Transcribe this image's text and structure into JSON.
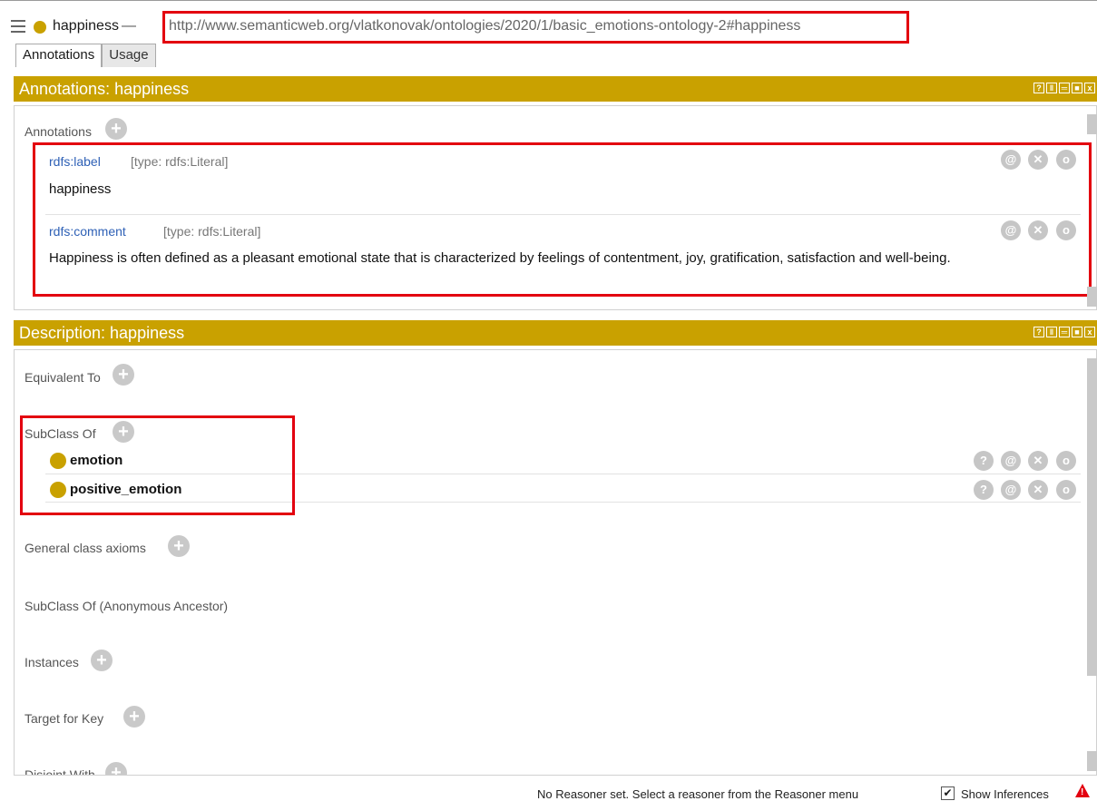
{
  "header": {
    "entity_name": "happiness",
    "separator": "—",
    "iri": "http://www.semanticweb.org/vlatkonovak/ontologies/2020/1/basic_emotions-ontology-2#happiness",
    "entity_color": "#c9a100"
  },
  "tabs": [
    {
      "label": "Annotations",
      "active": true
    },
    {
      "label": "Usage",
      "active": false
    }
  ],
  "annotations_view": {
    "title": "Annotations: happiness",
    "section_label": "Annotations",
    "items": [
      {
        "property": "rdfs:label",
        "type": "[type: rdfs:Literal]",
        "value": "happiness"
      },
      {
        "property": "rdfs:comment",
        "type": "[type: rdfs:Literal]",
        "value": "Happiness is often defined as a pleasant emotional state that is characterized by feelings of contentment, joy, gratification, satisfaction and well-being."
      }
    ]
  },
  "description_view": {
    "title": "Description: happiness",
    "sections": {
      "equivalent_to": "Equivalent To",
      "subclass_of": "SubClass Of",
      "general_axioms": "General class axioms",
      "anon_ancestor": "SubClass Of (Anonymous Ancestor)",
      "instances": "Instances",
      "target_for_key": "Target for Key",
      "disjoint_with": "Disjoint With"
    },
    "subclasses": [
      "emotion",
      "positive_emotion"
    ]
  },
  "icons": {
    "plus": "+",
    "question": "?",
    "at": "@",
    "delete": "✕",
    "edit": "o",
    "check": "✔",
    "warning": "!"
  },
  "status_bar": {
    "message": "No Reasoner set. Select a reasoner from the Reasoner menu",
    "show_inferences": "Show Inferences"
  },
  "colors": {
    "header_bar": "#c9a100",
    "highlight": "#e3000f",
    "link": "#2f61b6"
  }
}
